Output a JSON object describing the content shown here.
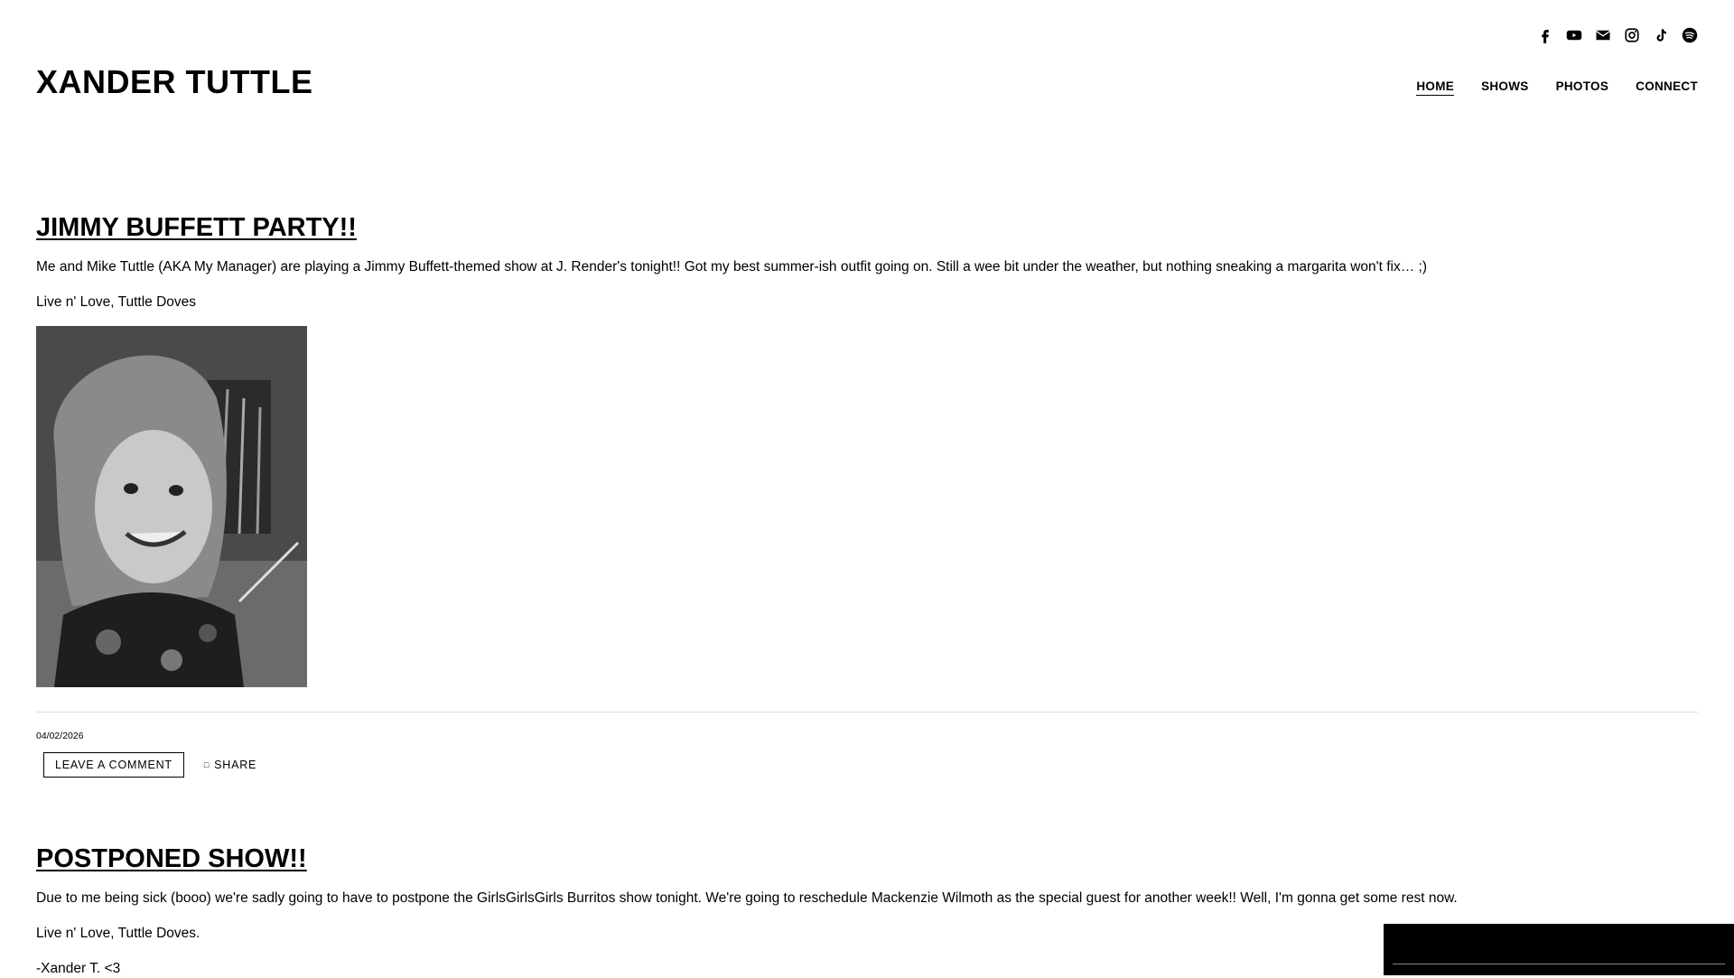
{
  "site": {
    "title": "XANDER TUTTLE"
  },
  "social": [
    {
      "name": "facebook-icon"
    },
    {
      "name": "youtube-icon"
    },
    {
      "name": "email-icon"
    },
    {
      "name": "instagram-icon"
    },
    {
      "name": "tiktok-icon"
    },
    {
      "name": "spotify-icon"
    }
  ],
  "nav": {
    "items": [
      {
        "label": "HOME",
        "active": true
      },
      {
        "label": "SHOWS"
      },
      {
        "label": "PHOTOS"
      },
      {
        "label": "CONNECT"
      }
    ]
  },
  "posts": [
    {
      "title": "JIMMY BUFFETT PARTY!!",
      "paragraphs": [
        "Me and Mike Tuttle (AKA My Manager) are playing a Jimmy Buffett-themed show at J. Render's tonight!! Got my best summer-ish outfit going on. Still a wee bit under the weather, but nothing sneaking a margarita won't fix… ;)",
        "Live n' Love, Tuttle Doves"
      ],
      "date": "04/02/2026",
      "comment_label": "LEAVE A COMMENT",
      "share_label": "SHARE"
    },
    {
      "title": "POSTPONED SHOW!!",
      "paragraphs": [
        "Due to me being sick (booo) we're sadly going to have to postpone the GirlsGirlsGirls Burritos show tonight. We're going to reschedule Mackenzie Wilmoth as the special guest for another week!! Well, I'm gonna get some rest now.",
        "Live n' Love, Tuttle Doves.",
        "-Xander T. <3"
      ]
    }
  ],
  "player": {
    "prev_icon": "",
    "play_icon": "",
    "next_icon": ""
  }
}
